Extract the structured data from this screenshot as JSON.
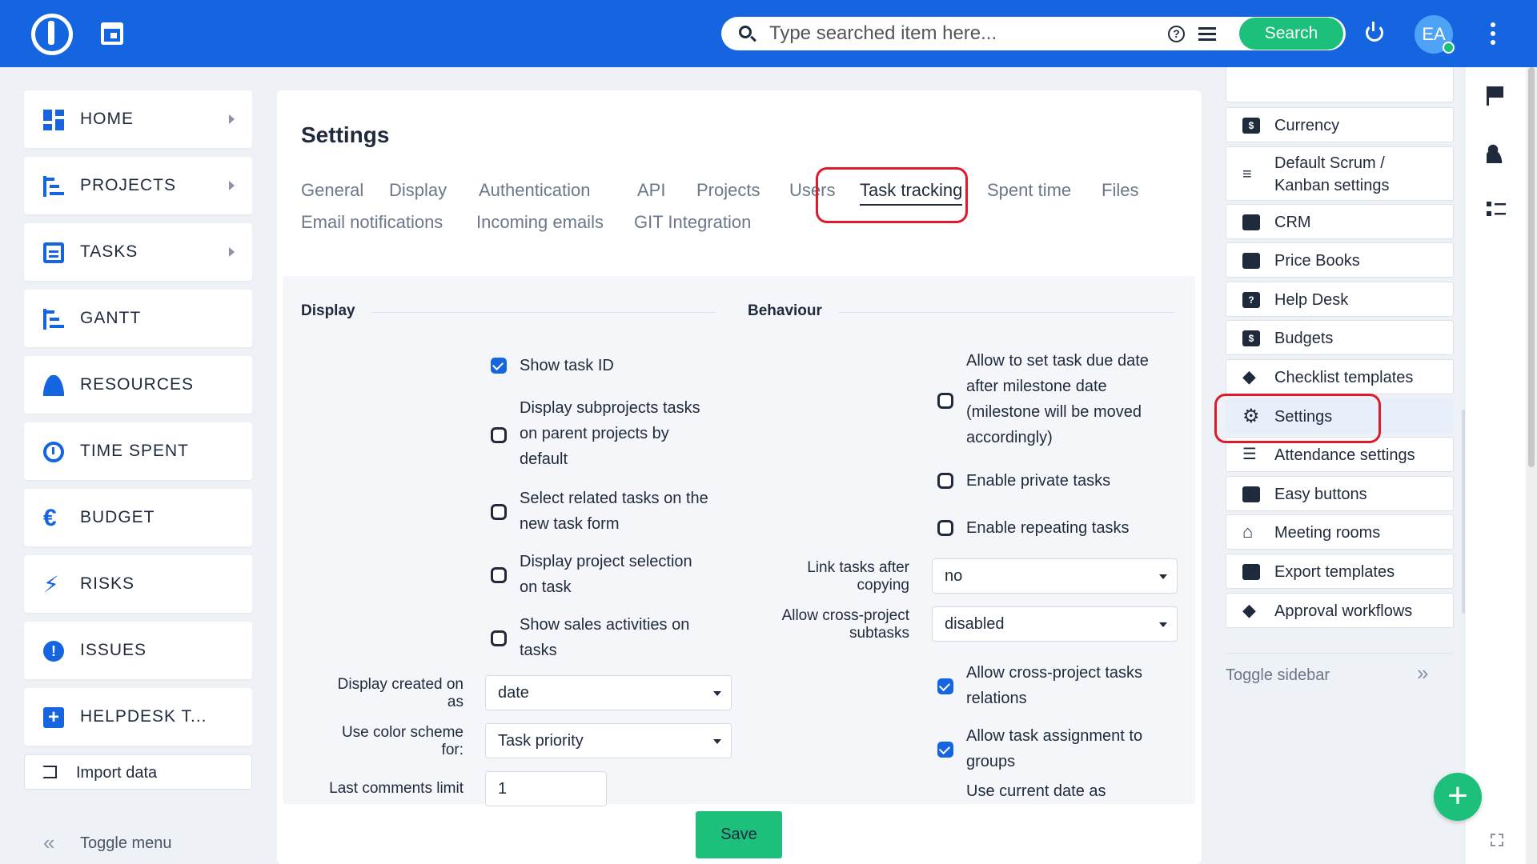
{
  "topbar": {
    "search_placeholder": "Type searched item here...",
    "search_button": "Search",
    "avatar_initials": "EA",
    "accent_color": "#1565e0",
    "success_color": "#1cc07a"
  },
  "leftmenu": {
    "items": [
      {
        "label": "HOME",
        "icon": "dashboard-icon",
        "has_arrow": true
      },
      {
        "label": "PROJECTS",
        "icon": "project-tree-icon",
        "has_arrow": true
      },
      {
        "label": "TASKS",
        "icon": "clipboard-icon",
        "has_arrow": true
      },
      {
        "label": "GANTT",
        "icon": "gantt-icon",
        "has_arrow": false
      },
      {
        "label": "RESOURCES",
        "icon": "person-icon",
        "has_arrow": false
      },
      {
        "label": "TIME SPENT",
        "icon": "stopwatch-icon",
        "has_arrow": false
      },
      {
        "label": "BUDGET",
        "icon": "euro-icon",
        "has_arrow": false
      },
      {
        "label": "RISKS",
        "icon": "bolt-icon",
        "has_arrow": false
      },
      {
        "label": "ISSUES",
        "icon": "alert-circle-icon",
        "has_arrow": false
      },
      {
        "label": "HELPDESK T...",
        "icon": "plus-square-icon",
        "has_arrow": false
      }
    ],
    "import_label": "Import data",
    "toggle_label": "Toggle menu"
  },
  "main": {
    "title": "Settings",
    "tabs_row1": [
      "General",
      "Display",
      "Authentication",
      "API",
      "Projects",
      "Users",
      "Task tracking",
      "Spent time",
      "Files"
    ],
    "tabs_row2": [
      "Email notifications",
      "Incoming emails",
      "GIT Integration"
    ],
    "active_tab": "Task tracking",
    "display": {
      "heading": "Display",
      "show_task_id": "Show task ID",
      "display_subprojects_l1": "Display subprojects tasks",
      "display_subprojects_l2": "on parent projects by",
      "display_subprojects_l3": "default",
      "select_related_l1": "Select related tasks on the",
      "select_related_l2": "new task form",
      "display_project_l1": "Display project selection",
      "display_project_l2": "on task",
      "show_sales_l1": "Show sales activities on",
      "show_sales_l2": "tasks",
      "created_on_l1": "Display created on",
      "created_on_l2": "as",
      "created_on_value": "date",
      "color_scheme_l1": "Use color scheme",
      "color_scheme_l2": "for:",
      "color_scheme_value": "Task priority",
      "comments_limit_label": "Last comments limit",
      "comments_limit_value": "1"
    },
    "behaviour": {
      "heading": "Behaviour",
      "due_date_l1": "Allow to set task due date",
      "due_date_l2": "after milestone date",
      "due_date_l3": "(milestone will be moved",
      "due_date_l4": "accordingly)",
      "private_tasks": "Enable private tasks",
      "repeating_tasks": "Enable repeating tasks",
      "link_tasks_l1": "Link tasks after",
      "link_tasks_l2": "copying",
      "link_tasks_value": "no",
      "cross_subtasks_l1": "Allow cross-project",
      "cross_subtasks_l2": "subtasks",
      "cross_subtasks_value": "disabled",
      "cross_relations_l1": "Allow cross-project tasks",
      "cross_relations_l2": "relations",
      "assign_groups_l1": "Allow task assignment to",
      "assign_groups_l2": "groups",
      "current_date_l1": "Use current date as"
    },
    "save_label": "Save"
  },
  "rsidebar": {
    "items": [
      {
        "label": "Currency",
        "icon": "currency-icon",
        "glyph": "$"
      },
      {
        "label": "Default Scrum /",
        "label2": "Kanban settings",
        "icon": "sort-lines-icon",
        "glyph": ""
      },
      {
        "label": "CRM",
        "icon": "briefcase-icon",
        "glyph": ""
      },
      {
        "label": "Price Books",
        "icon": "book-icon",
        "glyph": ""
      },
      {
        "label": "Help Desk",
        "icon": "help-square-icon",
        "glyph": "?"
      },
      {
        "label": "Budgets",
        "icon": "budget-icon",
        "glyph": "$"
      },
      {
        "label": "Checklist templates",
        "icon": "diamond-arrow-icon",
        "glyph": "◆"
      },
      {
        "label": "Settings",
        "icon": "gear-icon",
        "glyph": "⚙"
      },
      {
        "label": "Attendance settings",
        "icon": "sliders-icon",
        "glyph": ""
      },
      {
        "label": "Easy buttons",
        "icon": "grid-icon",
        "glyph": ""
      },
      {
        "label": "Meeting rooms",
        "icon": "home-icon",
        "glyph": ""
      },
      {
        "label": "Export templates",
        "icon": "printer-icon",
        "glyph": ""
      },
      {
        "label": "Approval workflows",
        "icon": "diamond-arrow-icon",
        "glyph": "◆"
      }
    ],
    "active_item": "Settings",
    "toggle_label": "Toggle sidebar"
  }
}
